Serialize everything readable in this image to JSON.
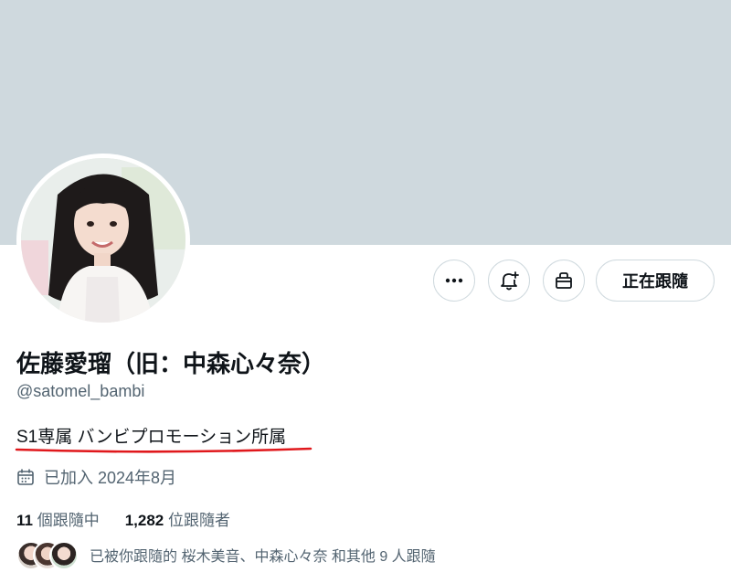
{
  "profile": {
    "display_name": "佐藤愛瑠（旧：中森心々奈）",
    "handle": "@satomel_bambi",
    "bio": "S1専属 バンビプロモーション所属",
    "joined": "已加入 2024年8月"
  },
  "actions": {
    "more_icon": "more-horizontal-icon",
    "notify_icon": "bell-plus-icon",
    "subscribe_icon": "gift-icon",
    "follow_label": "正在跟隨"
  },
  "stats": {
    "following_count": "11",
    "following_label": "個跟隨中",
    "followers_count": "1,282",
    "followers_label": "位跟隨者"
  },
  "followed_by": {
    "text": "已被你跟隨的 桜木美音、中森心々奈 和其他 9 人跟隨"
  },
  "colors": {
    "banner": "#cfd9de",
    "primary_text": "#0f1419",
    "secondary_text": "#536471",
    "border": "#cfd9de",
    "highlight_underline": "#e0181c"
  }
}
